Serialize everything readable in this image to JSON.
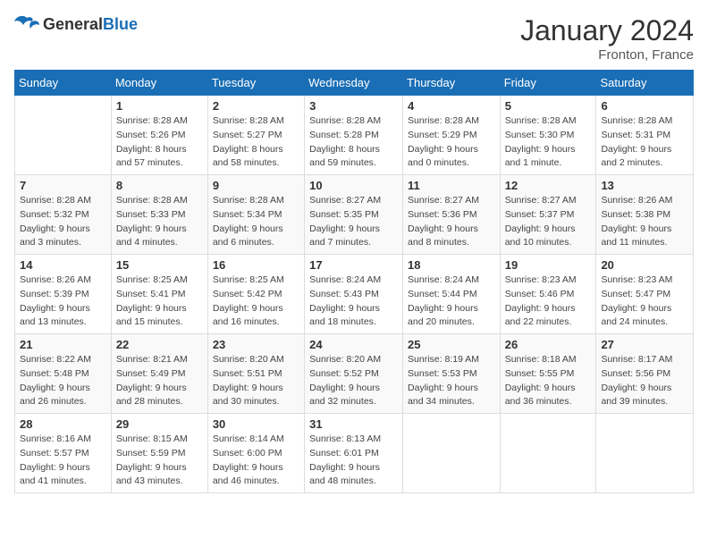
{
  "logo": {
    "general": "General",
    "blue": "Blue"
  },
  "header": {
    "month": "January 2024",
    "location": "Fronton, France"
  },
  "weekdays": [
    "Sunday",
    "Monday",
    "Tuesday",
    "Wednesday",
    "Thursday",
    "Friday",
    "Saturday"
  ],
  "weeks": [
    [
      {
        "day": "",
        "detail": ""
      },
      {
        "day": "1",
        "detail": "Sunrise: 8:28 AM\nSunset: 5:26 PM\nDaylight: 8 hours\nand 57 minutes."
      },
      {
        "day": "2",
        "detail": "Sunrise: 8:28 AM\nSunset: 5:27 PM\nDaylight: 8 hours\nand 58 minutes."
      },
      {
        "day": "3",
        "detail": "Sunrise: 8:28 AM\nSunset: 5:28 PM\nDaylight: 8 hours\nand 59 minutes."
      },
      {
        "day": "4",
        "detail": "Sunrise: 8:28 AM\nSunset: 5:29 PM\nDaylight: 9 hours\nand 0 minutes."
      },
      {
        "day": "5",
        "detail": "Sunrise: 8:28 AM\nSunset: 5:30 PM\nDaylight: 9 hours\nand 1 minute."
      },
      {
        "day": "6",
        "detail": "Sunrise: 8:28 AM\nSunset: 5:31 PM\nDaylight: 9 hours\nand 2 minutes."
      }
    ],
    [
      {
        "day": "7",
        "detail": "Sunrise: 8:28 AM\nSunset: 5:32 PM\nDaylight: 9 hours\nand 3 minutes."
      },
      {
        "day": "8",
        "detail": "Sunrise: 8:28 AM\nSunset: 5:33 PM\nDaylight: 9 hours\nand 4 minutes."
      },
      {
        "day": "9",
        "detail": "Sunrise: 8:28 AM\nSunset: 5:34 PM\nDaylight: 9 hours\nand 6 minutes."
      },
      {
        "day": "10",
        "detail": "Sunrise: 8:27 AM\nSunset: 5:35 PM\nDaylight: 9 hours\nand 7 minutes."
      },
      {
        "day": "11",
        "detail": "Sunrise: 8:27 AM\nSunset: 5:36 PM\nDaylight: 9 hours\nand 8 minutes."
      },
      {
        "day": "12",
        "detail": "Sunrise: 8:27 AM\nSunset: 5:37 PM\nDaylight: 9 hours\nand 10 minutes."
      },
      {
        "day": "13",
        "detail": "Sunrise: 8:26 AM\nSunset: 5:38 PM\nDaylight: 9 hours\nand 11 minutes."
      }
    ],
    [
      {
        "day": "14",
        "detail": "Sunrise: 8:26 AM\nSunset: 5:39 PM\nDaylight: 9 hours\nand 13 minutes."
      },
      {
        "day": "15",
        "detail": "Sunrise: 8:25 AM\nSunset: 5:41 PM\nDaylight: 9 hours\nand 15 minutes."
      },
      {
        "day": "16",
        "detail": "Sunrise: 8:25 AM\nSunset: 5:42 PM\nDaylight: 9 hours\nand 16 minutes."
      },
      {
        "day": "17",
        "detail": "Sunrise: 8:24 AM\nSunset: 5:43 PM\nDaylight: 9 hours\nand 18 minutes."
      },
      {
        "day": "18",
        "detail": "Sunrise: 8:24 AM\nSunset: 5:44 PM\nDaylight: 9 hours\nand 20 minutes."
      },
      {
        "day": "19",
        "detail": "Sunrise: 8:23 AM\nSunset: 5:46 PM\nDaylight: 9 hours\nand 22 minutes."
      },
      {
        "day": "20",
        "detail": "Sunrise: 8:23 AM\nSunset: 5:47 PM\nDaylight: 9 hours\nand 24 minutes."
      }
    ],
    [
      {
        "day": "21",
        "detail": "Sunrise: 8:22 AM\nSunset: 5:48 PM\nDaylight: 9 hours\nand 26 minutes."
      },
      {
        "day": "22",
        "detail": "Sunrise: 8:21 AM\nSunset: 5:49 PM\nDaylight: 9 hours\nand 28 minutes."
      },
      {
        "day": "23",
        "detail": "Sunrise: 8:20 AM\nSunset: 5:51 PM\nDaylight: 9 hours\nand 30 minutes."
      },
      {
        "day": "24",
        "detail": "Sunrise: 8:20 AM\nSunset: 5:52 PM\nDaylight: 9 hours\nand 32 minutes."
      },
      {
        "day": "25",
        "detail": "Sunrise: 8:19 AM\nSunset: 5:53 PM\nDaylight: 9 hours\nand 34 minutes."
      },
      {
        "day": "26",
        "detail": "Sunrise: 8:18 AM\nSunset: 5:55 PM\nDaylight: 9 hours\nand 36 minutes."
      },
      {
        "day": "27",
        "detail": "Sunrise: 8:17 AM\nSunset: 5:56 PM\nDaylight: 9 hours\nand 39 minutes."
      }
    ],
    [
      {
        "day": "28",
        "detail": "Sunrise: 8:16 AM\nSunset: 5:57 PM\nDaylight: 9 hours\nand 41 minutes."
      },
      {
        "day": "29",
        "detail": "Sunrise: 8:15 AM\nSunset: 5:59 PM\nDaylight: 9 hours\nand 43 minutes."
      },
      {
        "day": "30",
        "detail": "Sunrise: 8:14 AM\nSunset: 6:00 PM\nDaylight: 9 hours\nand 46 minutes."
      },
      {
        "day": "31",
        "detail": "Sunrise: 8:13 AM\nSunset: 6:01 PM\nDaylight: 9 hours\nand 48 minutes."
      },
      {
        "day": "",
        "detail": ""
      },
      {
        "day": "",
        "detail": ""
      },
      {
        "day": "",
        "detail": ""
      }
    ]
  ]
}
